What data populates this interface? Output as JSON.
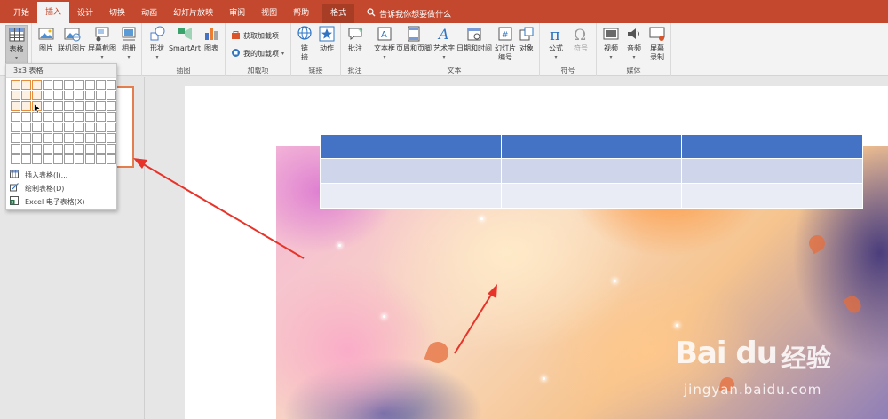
{
  "tabs": [
    "开始",
    "插入",
    "设计",
    "切换",
    "动画",
    "幻灯片放映",
    "审阅",
    "视图",
    "帮助",
    "格式"
  ],
  "active_tab": "插入",
  "tell_me": "告诉我你想要做什么",
  "ribbon": {
    "table": "表格",
    "picture": "图片",
    "online_picture": "联机图片",
    "screenshot": "屏幕截图",
    "album": "相册",
    "shapes": "形状",
    "smartart": "SmartArt",
    "chart": "图表",
    "group_illustrations": "插图",
    "get_addins": "获取加载项",
    "my_addins": "我的加载项",
    "group_addins": "加载项",
    "link_a": "链",
    "link_b": "接",
    "action": "动作",
    "group_links": "链接",
    "comment": "批注",
    "group_comments": "批注",
    "textbox": "文本框",
    "header_footer": "页眉和页脚",
    "wordart": "艺术字",
    "datetime": "日期和时间",
    "slide_number_a": "幻灯片",
    "slide_number_b": "编号",
    "object": "对象",
    "group_text": "文本",
    "equation": "公式",
    "symbol": "符号",
    "group_symbols": "符号",
    "video": "视频",
    "audio": "音频",
    "screen_rec_a": "屏幕",
    "screen_rec_b": "录制",
    "group_media": "媒体"
  },
  "dropdown": {
    "title": "3x3 表格",
    "grid_cols": 10,
    "grid_rows": 8,
    "selected_cols": 3,
    "selected_rows": 3,
    "insert_table": "插入表格(I)...",
    "draw_table": "绘制表格(D)",
    "excel_table": "Excel 电子表格(X)"
  },
  "watermark": {
    "logo": "Bai du",
    "cn": "经验",
    "url": "jingyan.baidu.com"
  },
  "colors": {
    "titlebar": "#c4482d",
    "table_header": "#4472c4",
    "table_row1": "#cfd5ea",
    "table_row2": "#e9ebf5",
    "arrow": "#e8332a",
    "selection": "#e48b3c"
  }
}
